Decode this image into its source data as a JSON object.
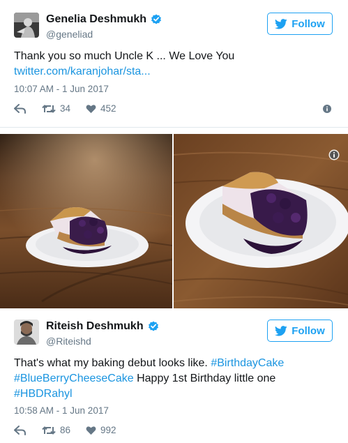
{
  "tweets": [
    {
      "author_name": "Genelia Deshmukh",
      "handle": "@geneliad",
      "follow_label": "Follow",
      "text": "Thank you so much Uncle K ... We Love You",
      "link_text": "twitter.com/karanjohar/sta...",
      "timestamp": "10:07 AM - 1 Jun 2017",
      "retweets": "34",
      "likes": "452"
    },
    {
      "author_name": "Riteish Deshmukh",
      "handle": "@Riteishd",
      "follow_label": "Follow",
      "text_plain_1": "That's what my baking debut looks like. ",
      "hashtag_1": "#BirthdayCake",
      "hashtag_2": "#BlueBerryCheeseCake",
      "text_plain_2": " Happy 1st Birthday little one",
      "hashtag_3": "#HBDRahyl",
      "timestamp": "10:58 AM - 1 Jun 2017",
      "retweets": "86",
      "likes": "992"
    }
  ],
  "media": {
    "photos": [
      "blueberry-cheesecake-photo-left",
      "blueberry-cheesecake-photo-right"
    ]
  },
  "colors": {
    "twitter_blue": "#1da1f2",
    "link_blue": "#1b95e0",
    "muted_gray": "#657786"
  }
}
